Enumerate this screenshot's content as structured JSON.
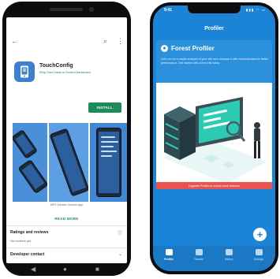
{
  "left_phone": {
    "store": {
      "app_title": "TouchConfig",
      "app_developer": "Strip Tune Danis or Kontrol Danismani",
      "install_label": "INSTALL",
      "shots_caption": "MFC Device Control App",
      "read_more_label": "READ MORE",
      "ratings": {
        "title": "Ratings and reviews",
        "subtitle": "No reviews yet"
      },
      "developer": {
        "title": "Developer contact"
      }
    },
    "colors": {
      "accent": "#1e8c5a",
      "app_icon": "#3d7fd0"
    }
  },
  "right_phone": {
    "status": {
      "time": "9:41",
      "icons": "▮▮▮ ◠ ▭"
    },
    "header_title": "Profiler",
    "card": {
      "title": "Forest Profiler",
      "body": "Let's run an in-depth analysis of your site and compare it with historical data for better performance. Get started with a free trial today."
    },
    "banner_text": "Upgrade Profiler to unlock more features",
    "fab_label": "+",
    "tabs": [
      {
        "label": "Profiler",
        "active": true
      },
      {
        "label": "Results",
        "active": false
      },
      {
        "label": "History",
        "active": false
      },
      {
        "label": "Settings",
        "active": false
      }
    ],
    "colors": {
      "primary": "#1c84d6",
      "banner": "#e8534f"
    }
  }
}
